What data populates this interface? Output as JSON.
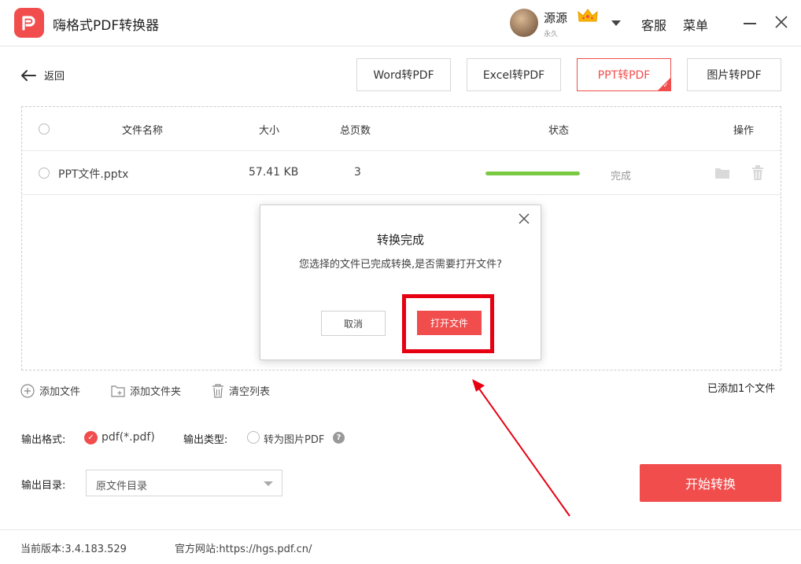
{
  "app": {
    "title": "嗨格式PDF转换器"
  },
  "user": {
    "name": "源源",
    "subtitle": "永久"
  },
  "titlebar": {
    "service": "客服",
    "menu": "菜单"
  },
  "nav": {
    "back_label": "返回"
  },
  "tabs": [
    {
      "label": "Word转PDF",
      "active": false
    },
    {
      "label": "Excel转PDF",
      "active": false
    },
    {
      "label": "PPT转PDF",
      "active": true
    },
    {
      "label": "图片转PDF",
      "active": false
    }
  ],
  "table": {
    "headers": {
      "name": "文件名称",
      "size": "大小",
      "pages": "总页数",
      "status": "状态",
      "actions": "操作"
    },
    "rows": [
      {
        "name": "PPT文件.pptx",
        "size": "57.41 KB",
        "pages": "3",
        "progress": 1.0,
        "status": "完成"
      }
    ]
  },
  "dialog": {
    "title": "转换完成",
    "message": "您选择的文件已完成转换,是否需要打开文件?",
    "cancel_label": "取消",
    "open_label": "打开文件"
  },
  "actions": {
    "add_file": "添加文件",
    "add_folder": "添加文件夹",
    "clear_list": "清空列表",
    "added_count": "已添加1个文件"
  },
  "output": {
    "format_label": "输出格式:",
    "format_value": "pdf(*.pdf)",
    "type_label": "输出类型:",
    "type_option": "转为图片PDF",
    "dir_label": "输出目录:",
    "dir_value": "原文件目录"
  },
  "start_label": "开始转换",
  "footer": {
    "version": "当前版本:3.4.183.529",
    "website": "官方网站:https://hgs.pdf.cn/"
  },
  "colors": {
    "accent": "#f14d4d",
    "progress": "#7ac943",
    "highlight": "#e60012"
  }
}
